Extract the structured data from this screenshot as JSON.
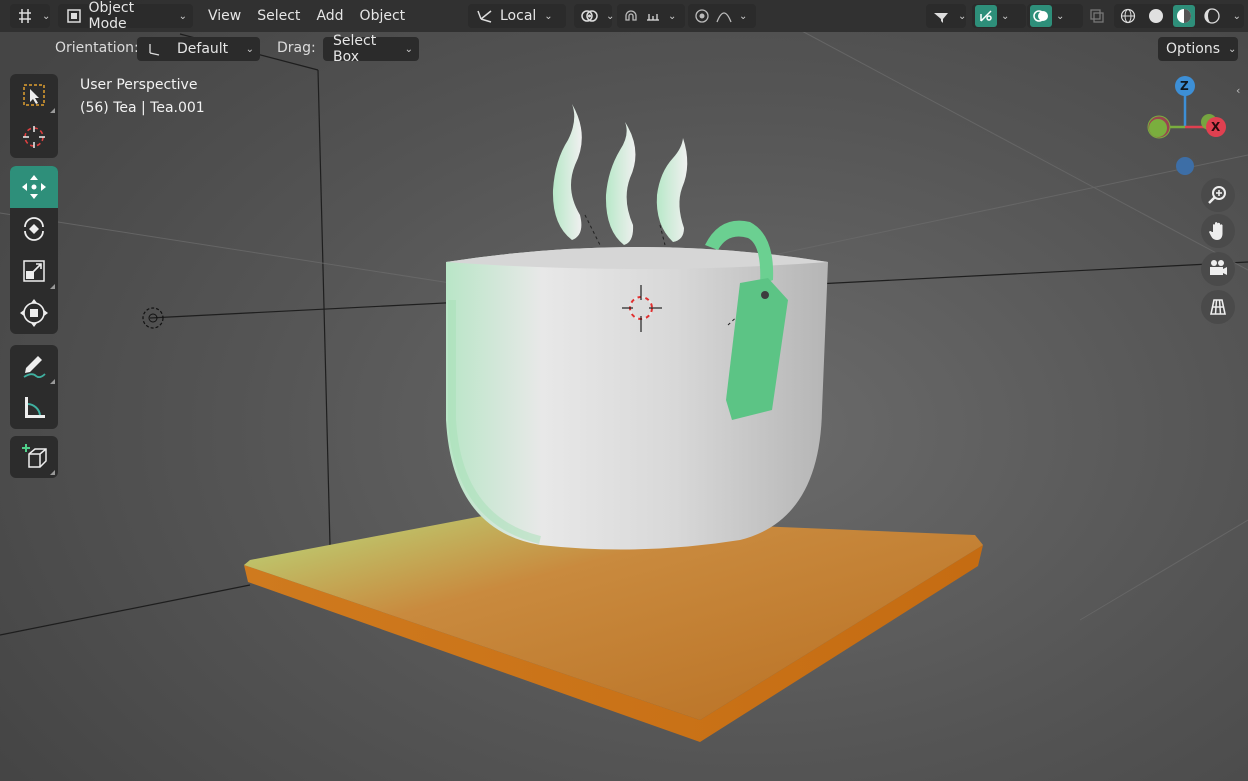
{
  "header": {
    "mode": "Object Mode",
    "menu": [
      "View",
      "Select",
      "Add",
      "Object"
    ],
    "transform_orientation": "Local",
    "options_label": "Options"
  },
  "tool_header": {
    "orientation_label": "Orientation:",
    "orientation_value": "Default",
    "drag_label": "Drag:",
    "drag_value": "Select Box"
  },
  "viewport": {
    "perspective": "User Perspective",
    "object_info": "(56) Tea | Tea.001"
  },
  "gizmo": {
    "z": "Z",
    "x": "X"
  },
  "colors": {
    "accent": "#2e8f7a",
    "axis_x": "#e04050",
    "axis_y": "#7aae3e",
    "axis_z": "#3d8fd6",
    "tray": "#c8761e",
    "tea_bag": "#5fcf8a"
  },
  "tools": [
    "select-box-icon",
    "cursor-icon",
    "move-icon",
    "rotate-icon",
    "scale-icon",
    "transform-icon",
    "annotate-icon",
    "measure-icon",
    "add-cube-icon"
  ],
  "nav_buttons": [
    "zoom-icon",
    "hand-icon",
    "camera-icon",
    "grid-icon"
  ]
}
